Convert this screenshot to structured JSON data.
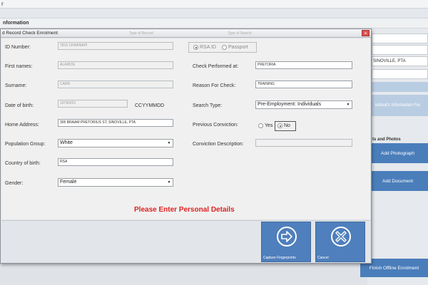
{
  "background_app": {
    "title_fragment": "r",
    "section_label": "nformation",
    "address_fragment": "SINOVILLE, PTA",
    "info_button": "ividual's Information For",
    "photos_label": "ts and Photos",
    "add_photograph": "Add Photograph",
    "add_document": "Add Document",
    "finish_button": "Finish Offline Enrolment"
  },
  "dialog": {
    "title": "d Record Check Enrolment",
    "close_label": "×",
    "ghost_title_1": "Type of Record",
    "ghost_title_2": "Type of Search"
  },
  "form": {
    "id_number": {
      "label": "ID Number:",
      "value": "7815 CRIMINAPI"
    },
    "id_type": {
      "options": [
        "RSA ID",
        "Passport"
      ],
      "selected": "RSA ID"
    },
    "first_names": {
      "label": "First names:",
      "value": "ALARICE"
    },
    "surname": {
      "label": "Surname:",
      "value": "CARR"
    },
    "date_of_birth": {
      "label": "Date of birth:",
      "value": "19790201",
      "format_hint": "CCYYMMDD"
    },
    "home_address": {
      "label": "Home Address:",
      "value": "305 BRAAM PRETORIUS ST, SINOVILLE, PTA"
    },
    "population_group": {
      "label": "Population Group:",
      "value": "White"
    },
    "country_of_birth": {
      "label": "Country of birth:",
      "value": "RSA"
    },
    "gender": {
      "label": "Gender:",
      "value": "Female"
    },
    "check_performed_at": {
      "label": "Check Performed at:",
      "value": "PRETORIA"
    },
    "reason_for_check": {
      "label": "Reason For Check:",
      "value": "TRAINING"
    },
    "search_type": {
      "label": "Search Type:",
      "value": "Pre-Employment: Individuals"
    },
    "previous_conviction": {
      "label": "Previous Conviction:",
      "options": [
        "Yes",
        "No"
      ],
      "selected": "No"
    },
    "conviction_description": {
      "label": "Conviction Description:",
      "value": ""
    }
  },
  "message": "Please Enter Personal Details",
  "actions": {
    "capture_fingerprints": "Capture Fingerprints",
    "cancel": "Cancel"
  },
  "colors": {
    "accent_blue": "#4f7fbc",
    "message_red": "#dd2222",
    "close_red": "#d9534f"
  }
}
